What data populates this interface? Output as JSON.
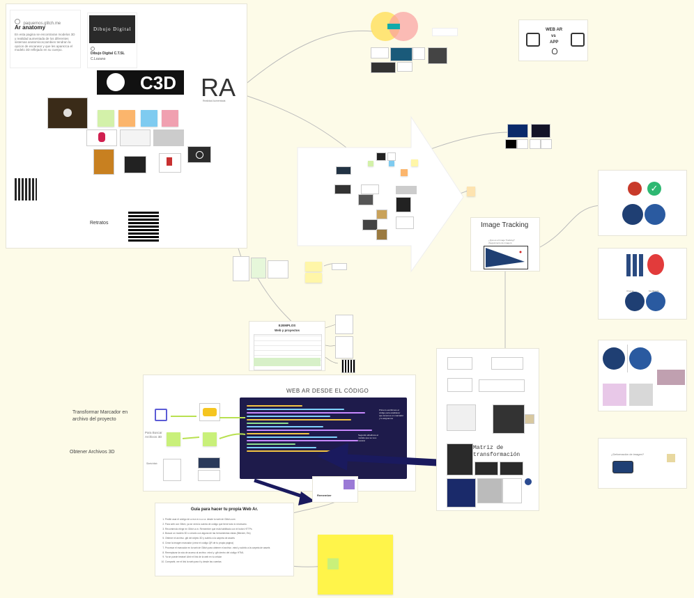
{
  "colors": {
    "canvas": "#fdfbe8",
    "sticky_yellow": "#fff6a8",
    "sticky_big": "#fff44a",
    "code_bg": "#1e1b4b",
    "arrow_navy": "#1a1a5e",
    "flower_blue": "#1f3f73",
    "lime": "#c9f07a"
  },
  "profile_card": {
    "site": "paquemos.glitch.me",
    "title": "Ar anatomy",
    "description": "En esta pagina se encontraran modelos 3D y realidad aumentada de los diferentes sistemas anatomicos,tambien tendran la opcion de escanear y que les aparezca el modelo 3D reflejado en su cuerpo."
  },
  "course_card": {
    "banner": "Dibujo Digital",
    "name": "Dibujo Digital C.T.SL",
    "sub": "C.Lozano"
  },
  "logo_text": "C3D",
  "ra_title": "RA",
  "ra_subtitle": "Realidad Aumentada",
  "retratos_label": "Retratos",
  "image_tracking": {
    "title": "Image Tracking",
    "caption": "¿Qué es el Image Tracking? (Seguimiento de imagen)"
  },
  "webar_card": {
    "lines": [
      "WEB AR",
      "vs",
      "APP"
    ]
  },
  "ejemplos_table": {
    "title": "EJEMPLOS",
    "subtitle": "Web y proyectos"
  },
  "code_section": {
    "title": "WEB AR DESDE EL CÓDIGO",
    "transform_label": "Transformar Marcador en archivo del proyecto",
    "obtain_label": "Obtener Archivos 3D",
    "para_buscar": "Para Buscar Archivos 3D",
    "sketchfab_label": "Sketchfab",
    "remember_label": "Remember",
    "callout_1": "Primero escribimos el código para establecer que tenemos un marcador y lo asignamos",
    "callout_2": "Segundo añadimos el modelo que se va a mostrar"
  },
  "matrix_label": "Matriz de transformación",
  "guide": {
    "title": "Guía para hacer tu propia Web Ar.",
    "steps": [
      "Pedile usar el código de a.m.e.m.n.o.r.a. desde tu web de Glitch.com",
      "Para web con Glitch, ya se verá la cuenta de código que tiene todo lo necesario.",
      "Recomiendo elegir en Glitch a.m. Remember que está habilitado con el botón HTTPs",
      "Buscar un modelo 3D o crearlo con alguna de las herramientas vistas (Blender, Etc)",
      "Obtener el archivo .glb del objeto 3D y subirlo a la carpeta de assets",
      "Crear la imagen marcador (crear el código QR de tu propia página)",
      "Procesar el marcador en la web de Glitch para obtener el archivo .mind y subirlo a la carpeta de assets",
      "Reemplazar la ruta de acceso al archivo .mind y .glb dentro del código HTML",
      "Ya se puede testear! Abrir el link de la web en tu celular",
      "Compartir, ver el link la web para ti y desde las cuentas"
    ]
  },
  "deformation_card": {
    "title": "¿Deformación de imagen?"
  },
  "flower_labels": [
    "Original",
    "Modificada"
  ]
}
